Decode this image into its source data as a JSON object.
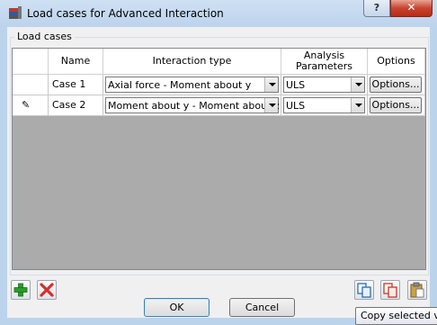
{
  "window": {
    "title": "Load cases for Advanced Interaction"
  },
  "titlebar_buttons": {
    "help": "?",
    "close": "✕"
  },
  "group": {
    "label": "Load cases"
  },
  "table": {
    "headers": {
      "name": "Name",
      "interaction_type": "Interaction type",
      "analysis_parameters": "Analysis Parameters",
      "options": "Options"
    },
    "rows": [
      {
        "indicator": "",
        "name": "Case 1",
        "interaction_type": "Axial force - Moment about y",
        "analysis": "ULS",
        "options_label": "Options..."
      },
      {
        "indicator": "✎",
        "name": "Case 2",
        "interaction_type": "Moment about y - Moment about z",
        "analysis": "ULS",
        "options_label": "Options..."
      }
    ]
  },
  "buttons": {
    "ok": "OK",
    "cancel": "Cancel"
  },
  "tooltip": "Copy selected va",
  "icons": {
    "add": "plus-icon",
    "delete": "delete-icon",
    "copy": "copy-icon",
    "copy_alt": "copy-alt-icon",
    "paste": "paste-icon"
  },
  "colors": {
    "add": "#2a9d2a",
    "delete": "#d32f2f",
    "title_bg": "#bcd3ec",
    "close_bg": "#c7442f"
  }
}
